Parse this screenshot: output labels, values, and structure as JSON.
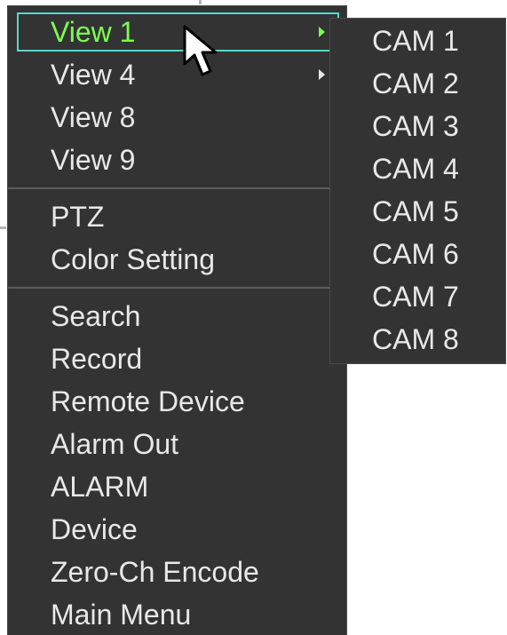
{
  "main_menu": {
    "items": [
      {
        "label": "View 1",
        "has_submenu": true,
        "selected": true
      },
      {
        "label": "View 4",
        "has_submenu": true
      },
      {
        "label": "View 8"
      },
      {
        "label": "View 9"
      },
      {
        "label": "PTZ"
      },
      {
        "label": "Color Setting"
      },
      {
        "label": "Search"
      },
      {
        "label": "Record"
      },
      {
        "label": "Remote Device"
      },
      {
        "label": "Alarm Out"
      },
      {
        "label": "ALARM"
      },
      {
        "label": "Device"
      },
      {
        "label": "Zero-Ch Encode"
      },
      {
        "label": "Main Menu"
      }
    ]
  },
  "submenu": {
    "items": [
      "CAM 1",
      "CAM 2",
      "CAM 3",
      "CAM 4",
      "CAM 5",
      "CAM 6",
      "CAM 7",
      "CAM 8"
    ]
  },
  "colors": {
    "menu_background": "#333333",
    "text": "#e8e8e8",
    "selected_text": "#7cfc52",
    "selection_border": "#58d6d0"
  },
  "icons": {
    "pointer": "mouse-pointer-icon",
    "submenu_indicator": "submenu-arrow-icon"
  }
}
